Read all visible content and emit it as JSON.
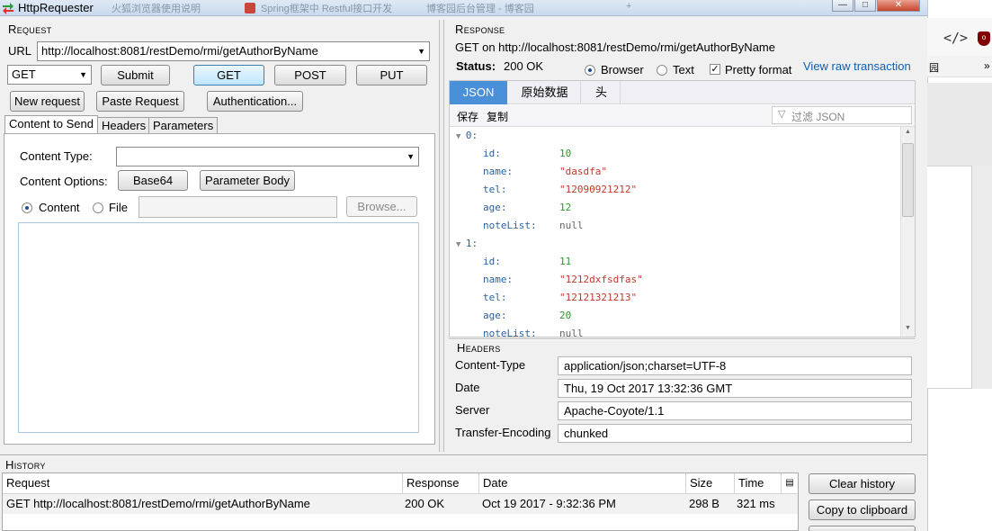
{
  "window": {
    "title": "HttpRequester",
    "background_tabs": [
      "火狐浏览器使用说明",
      "Spring框架中 Restful接口开发",
      "博客园后台管理 - 博客园"
    ]
  },
  "request": {
    "section_title": "Request",
    "url_label": "URL",
    "url_value": "http://localhost:8081/restDemo/rmi/getAuthorByName",
    "method_selected": "GET",
    "buttons": {
      "submit": "Submit",
      "get": "GET",
      "post": "POST",
      "put": "PUT",
      "new_request": "New request",
      "paste_request": "Paste Request",
      "authentication": "Authentication..."
    },
    "tabs": [
      "Content to Send",
      "Headers",
      "Parameters"
    ],
    "content_type_label": "Content Type:",
    "content_type_value": "",
    "content_options_label": "Content Options:",
    "base64": "Base64",
    "parameter_body": "Parameter Body",
    "content_radio": "Content",
    "file_radio": "File",
    "browse": "Browse..."
  },
  "response": {
    "section_title": "Response",
    "summary": "GET on http://localhost:8081/restDemo/rmi/getAuthorByName",
    "status_label": "Status:",
    "status_value": "200 OK",
    "view_browser": "Browser",
    "view_text": "Text",
    "pretty_format": "Pretty format",
    "view_raw": "View raw transaction",
    "tabs": [
      "JSON",
      "原始数据",
      "头"
    ],
    "toolbar": {
      "save": "保存",
      "copy": "复制",
      "filter_placeholder": "过滤 JSON"
    },
    "json_lines": [
      {
        "indent": 0,
        "key": "0:",
        "twisty": true
      },
      {
        "indent": 1,
        "key": "id:",
        "value": "10",
        "kind": "num"
      },
      {
        "indent": 1,
        "key": "name:",
        "value": "\"dasdfa\"",
        "kind": "str"
      },
      {
        "indent": 1,
        "key": "tel:",
        "value": "\"12090921212\"",
        "kind": "str"
      },
      {
        "indent": 1,
        "key": "age:",
        "value": "12",
        "kind": "num"
      },
      {
        "indent": 1,
        "key": "noteList:",
        "value": "null",
        "kind": "null"
      },
      {
        "indent": 0,
        "key": "1:",
        "twisty": true
      },
      {
        "indent": 1,
        "key": "id:",
        "value": "11",
        "kind": "num"
      },
      {
        "indent": 1,
        "key": "name:",
        "value": "\"1212dxfsdfas\"",
        "kind": "str"
      },
      {
        "indent": 1,
        "key": "tel:",
        "value": "\"12121321213\"",
        "kind": "str"
      },
      {
        "indent": 1,
        "key": "age:",
        "value": "20",
        "kind": "num"
      },
      {
        "indent": 1,
        "key": "noteList:",
        "value": "null",
        "kind": "null"
      }
    ],
    "headers_title": "Headers",
    "headers": [
      {
        "name": "Content-Type",
        "value": "application/json;charset=UTF-8"
      },
      {
        "name": "Date",
        "value": "Thu, 19 Oct 2017 13:32:36 GMT"
      },
      {
        "name": "Server",
        "value": "Apache-Coyote/1.1"
      },
      {
        "name": "Transfer-Encoding",
        "value": "chunked"
      }
    ]
  },
  "history": {
    "section_title": "History",
    "columns": [
      "Request",
      "Response",
      "Date",
      "Size",
      "Time"
    ],
    "rows": [
      [
        "GET http://localhost:8081/restDemo/rmi/getAuthorByName",
        "200 OK",
        "Oct 19 2017 - 9:32:36 PM",
        "298 B",
        "321 ms"
      ]
    ],
    "clear": "Clear history",
    "copy": "Copy to clipboard"
  },
  "browser_strip": {
    "tab_text": "园",
    "overflow": "»"
  },
  "colors": {
    "json_tab_active": "#4a90d9",
    "link": "#0b5fb3",
    "json_key": "#2b61a1",
    "json_number": "#2b9a2b",
    "json_string": "#c0392b"
  }
}
